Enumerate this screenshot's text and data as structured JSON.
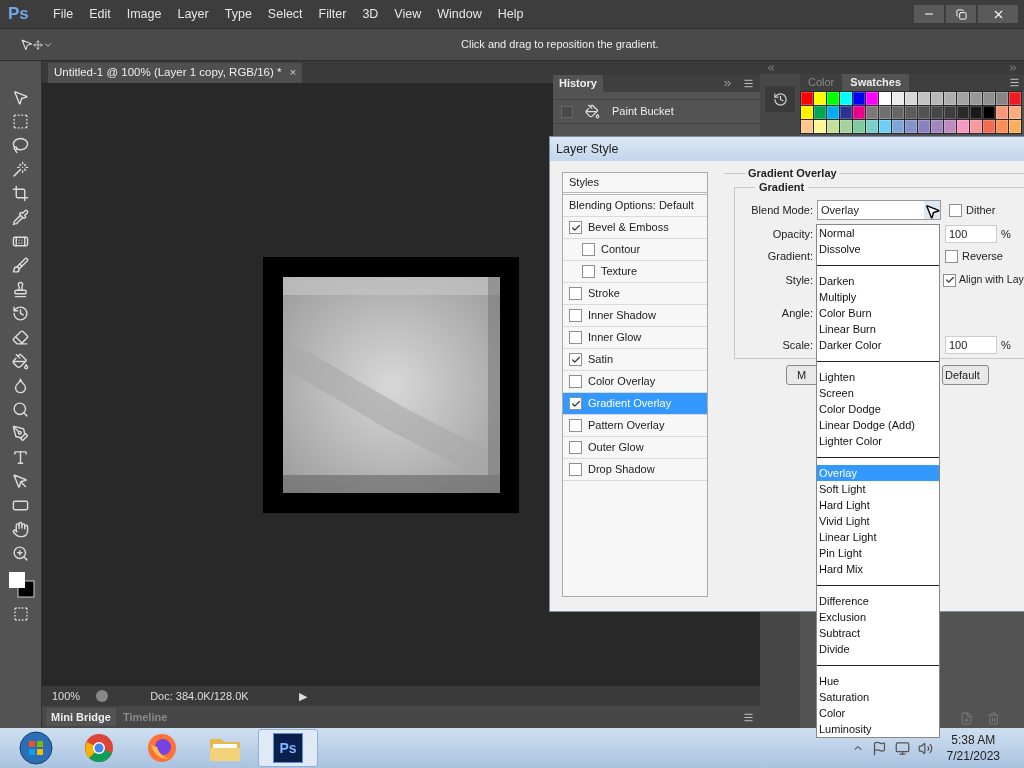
{
  "menu_bar": {
    "logo": "Ps",
    "items": [
      "File",
      "Edit",
      "Image",
      "Layer",
      "Type",
      "Select",
      "Filter",
      "3D",
      "View",
      "Window",
      "Help"
    ]
  },
  "options_bar": {
    "hint": "Click and drag to reposition the gradient."
  },
  "document_tab": {
    "title": "Untitled-1 @ 100% (Layer 1 copy, RGB/16) *",
    "close": "×"
  },
  "status_bar": {
    "zoom": "100%",
    "doc_size": "Doc: 384.0K/128.0K",
    "menu_arrow": "▶"
  },
  "bottom_panel_tabs": [
    {
      "label": "Mini Bridge",
      "selected": true
    },
    {
      "label": "Timeline",
      "selected": false
    }
  ],
  "history_panel": {
    "title": "History",
    "items": [
      {
        "label": "Paint Bucket",
        "checked": false
      }
    ]
  },
  "swatches_panel": {
    "tabs": [
      {
        "label": "Color",
        "selected": false
      },
      {
        "label": "Swatches",
        "selected": true
      }
    ],
    "swatches": [
      {
        "color": "#ff0000"
      },
      {
        "color": "#ffff00"
      },
      {
        "color": "#00ff00"
      },
      {
        "color": "#00ffff"
      },
      {
        "color": "#0000ff"
      },
      {
        "color": "#ff00ff"
      },
      {
        "color": "#ffffff"
      },
      {
        "color": "#ebebeb"
      },
      {
        "color": "#d6d6d6"
      },
      {
        "color": "#c2c2c2"
      },
      {
        "color": "#b8b8b8"
      },
      {
        "color": "#adadad"
      },
      {
        "color": "#a3a3a3"
      },
      {
        "color": "#999999"
      },
      {
        "color": "#8f8f8f"
      },
      {
        "color": "#858585"
      },
      {
        "color": "#ed1c24"
      },
      {
        "color": "#fff200"
      },
      {
        "color": "#00a651"
      },
      {
        "color": "#00aeef"
      },
      {
        "color": "#2e3192"
      },
      {
        "color": "#ec008c"
      },
      {
        "color": "#7a7a7a"
      },
      {
        "color": "#707070"
      },
      {
        "color": "#666666"
      },
      {
        "color": "#5c5c5c"
      },
      {
        "color": "#525252"
      },
      {
        "color": "#474747"
      },
      {
        "color": "#3d3d3d"
      },
      {
        "color": "#2a2a2a"
      },
      {
        "color": "#1a1a1a"
      },
      {
        "color": "#000000"
      },
      {
        "color": "#f7977a"
      },
      {
        "color": "#f9ad81"
      },
      {
        "color": "#fdc68a"
      },
      {
        "color": "#fff79a"
      },
      {
        "color": "#c4df9b"
      },
      {
        "color": "#a3d39c"
      },
      {
        "color": "#82ca9d"
      },
      {
        "color": "#7bcdc8"
      },
      {
        "color": "#6ecff6"
      },
      {
        "color": "#7ea7d8"
      },
      {
        "color": "#8493ca"
      },
      {
        "color": "#8882be"
      },
      {
        "color": "#a187be"
      },
      {
        "color": "#bc8dbf"
      },
      {
        "color": "#f49ac2"
      },
      {
        "color": "#f6989d"
      },
      {
        "color": "#f26c4f"
      },
      {
        "color": "#f68e55"
      },
      {
        "color": "#fbaf5d"
      }
    ]
  },
  "layer_style_dialog": {
    "title": "Layer Style",
    "styles_header": "Styles",
    "blending_options": "Blending Options: Default",
    "effects": [
      {
        "label": "Bevel & Emboss",
        "checked": true,
        "selected": false,
        "children": [
          {
            "label": "Contour",
            "checked": false,
            "selected": false
          },
          {
            "label": "Texture",
            "checked": false,
            "selected": false
          }
        ]
      },
      {
        "label": "Stroke",
        "checked": false,
        "selected": false
      },
      {
        "label": "Inner Shadow",
        "checked": false,
        "selected": false
      },
      {
        "label": "Inner Glow",
        "checked": false,
        "selected": false
      },
      {
        "label": "Satin",
        "checked": true,
        "selected": false
      },
      {
        "label": "Color Overlay",
        "checked": false,
        "selected": false
      },
      {
        "label": "Gradient Overlay",
        "checked": true,
        "selected": true
      },
      {
        "label": "Pattern Overlay",
        "checked": false,
        "selected": false
      },
      {
        "label": "Outer Glow",
        "checked": false,
        "selected": false
      },
      {
        "label": "Drop Shadow",
        "checked": false,
        "selected": false
      }
    ],
    "section_title": "Gradient Overlay",
    "group_title": "Gradient",
    "blend_mode": {
      "label": "Blend Mode:",
      "value": "Overlay"
    },
    "dither": {
      "label": "Dither",
      "checked": false
    },
    "opacity": {
      "label": "Opacity:",
      "value": "100",
      "unit": "%"
    },
    "gradient_label": "Gradient:",
    "reverse": {
      "label": "Reverse",
      "checked": false
    },
    "style_label": "Style:",
    "align": {
      "label": "Align with Lay",
      "checked": true
    },
    "angle_label": "Angle:",
    "scale": {
      "label": "Scale:",
      "value": "100",
      "unit": "%"
    },
    "buttons": [
      "M",
      "Default"
    ]
  },
  "blend_mode_menu": {
    "groups": [
      {
        "items": [
          {
            "label": "Normal",
            "selected": false
          },
          {
            "label": "Dissolve",
            "selected": false
          }
        ]
      },
      {
        "items": [
          {
            "label": "Darken",
            "selected": false
          },
          {
            "label": "Multiply",
            "selected": false
          },
          {
            "label": "Color Burn",
            "selected": false
          },
          {
            "label": "Linear Burn",
            "selected": false
          },
          {
            "label": "Darker Color",
            "selected": false
          }
        ]
      },
      {
        "items": [
          {
            "label": "Lighten",
            "selected": false
          },
          {
            "label": "Screen",
            "selected": false
          },
          {
            "label": "Color Dodge",
            "selected": false
          },
          {
            "label": "Linear Dodge (Add)",
            "selected": false
          },
          {
            "label": "Lighter Color",
            "selected": false
          }
        ]
      },
      {
        "items": [
          {
            "label": "Overlay",
            "selected": true
          },
          {
            "label": "Soft Light",
            "selected": false
          },
          {
            "label": "Hard Light",
            "selected": false
          },
          {
            "label": "Vivid Light",
            "selected": false
          },
          {
            "label": "Linear Light",
            "selected": false
          },
          {
            "label": "Pin Light",
            "selected": false
          },
          {
            "label": "Hard Mix",
            "selected": false
          }
        ]
      },
      {
        "items": [
          {
            "label": "Difference",
            "selected": false
          },
          {
            "label": "Exclusion",
            "selected": false
          },
          {
            "label": "Subtract",
            "selected": false
          },
          {
            "label": "Divide",
            "selected": false
          }
        ]
      },
      {
        "items": [
          {
            "label": "Hue",
            "selected": false
          },
          {
            "label": "Saturation",
            "selected": false
          },
          {
            "label": "Color",
            "selected": false
          },
          {
            "label": "Luminosity",
            "selected": false
          }
        ]
      }
    ]
  },
  "taskbar": {
    "apps": [
      {
        "kind": "start",
        "selected": false
      },
      {
        "kind": "chrome",
        "selected": false
      },
      {
        "kind": "firefox",
        "selected": false
      },
      {
        "kind": "folder",
        "selected": false
      },
      {
        "kind": "photoshop",
        "label": "Ps",
        "selected": true
      }
    ],
    "time": "5:38 AM",
    "date": "7/21/2023"
  }
}
